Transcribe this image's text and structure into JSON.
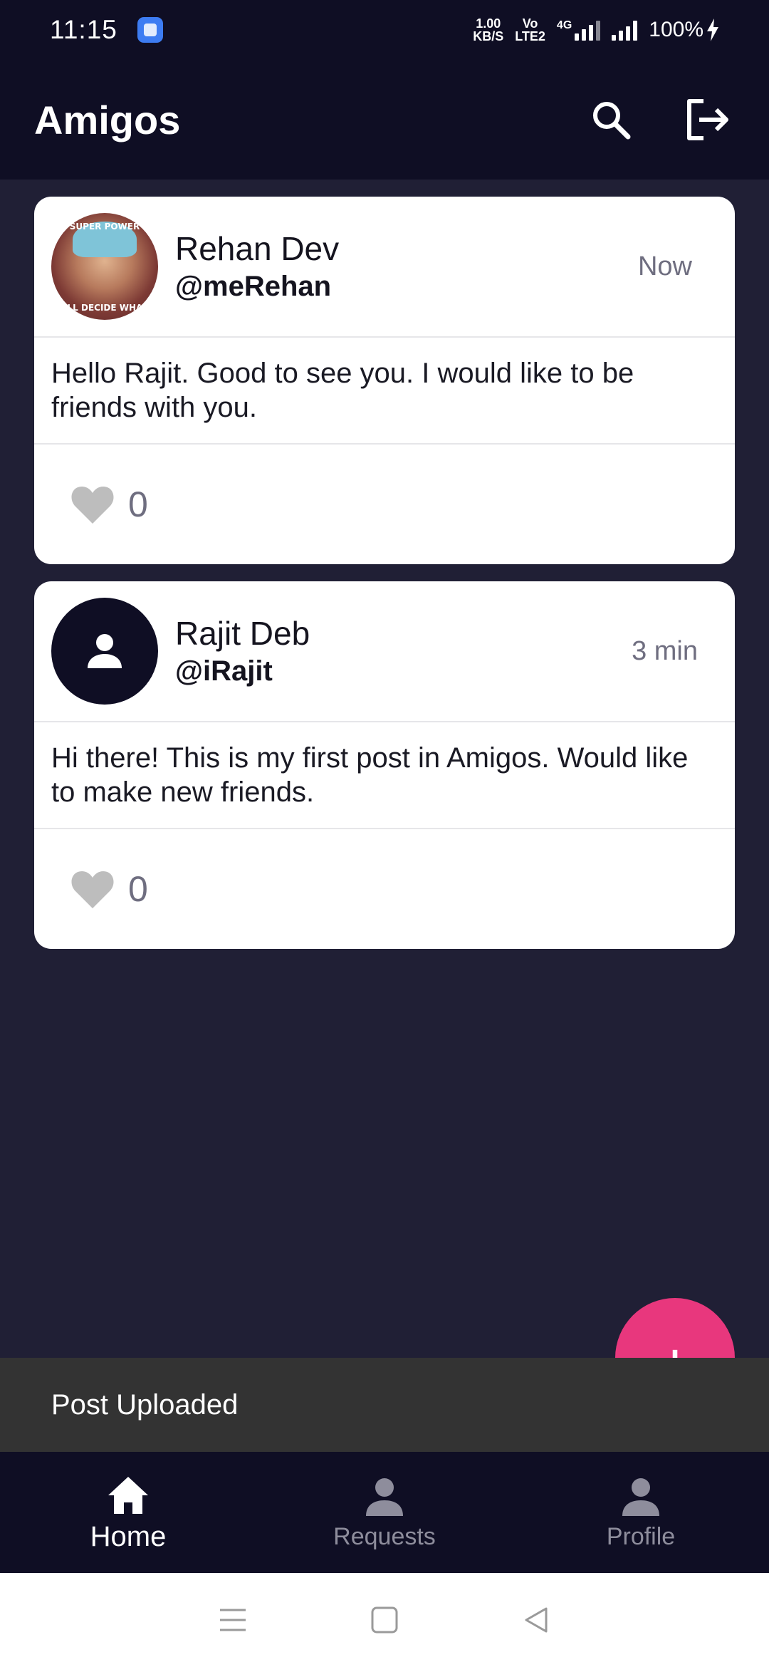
{
  "status_bar": {
    "time": "11:15",
    "network_speed_value": "1.00",
    "network_speed_unit": "KB/S",
    "volte_top": "Vo",
    "volte_bottom": "LTE2",
    "network_type": "4G",
    "battery": "100%"
  },
  "app_bar": {
    "title": "Amigos",
    "icons": [
      "search-icon",
      "logout-icon"
    ]
  },
  "posts": [
    {
      "name": "Rehan Dev",
      "handle": "@meRehan",
      "time": "Now",
      "text": "Hello Rajit. Good to see you. I would like to be friends with you.",
      "likes": "0",
      "avatar_text_top": "SUPER POWER",
      "avatar_text_bottom": "I'LL DECIDE WHAT"
    },
    {
      "name": "Rajit Deb",
      "handle": "@iRajit",
      "time": "3 min",
      "text": "Hi there! This is my first post in Amigos. Would like to make new friends.",
      "likes": "0"
    }
  ],
  "fab": {
    "label": "+"
  },
  "snackbar": {
    "message": "Post Uploaded"
  },
  "bottom_nav": {
    "items": [
      {
        "label": "Home",
        "icon": "home-icon",
        "active": true
      },
      {
        "label": "Requests",
        "icon": "person-icon",
        "active": false
      },
      {
        "label": "Profile",
        "icon": "person-icon",
        "active": false
      }
    ]
  },
  "colors": {
    "background": "#201f35",
    "bar": "#0f0e24",
    "accent": "#e8377d",
    "card": "#ffffff"
  }
}
